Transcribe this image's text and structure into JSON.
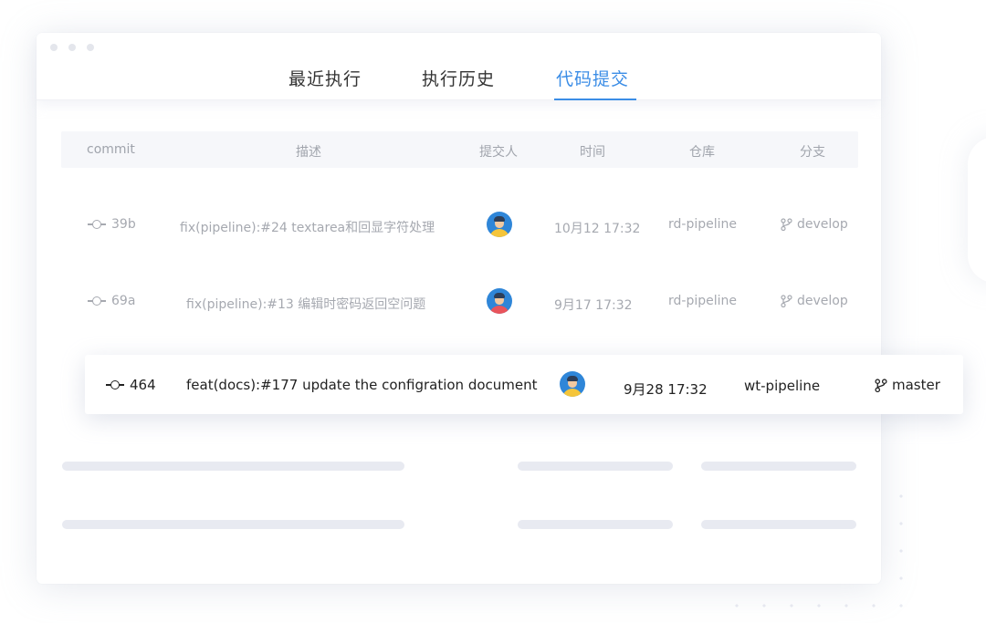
{
  "tabs": [
    {
      "label": "最近执行",
      "active": false
    },
    {
      "label": "执行历史",
      "active": false
    },
    {
      "label": "代码提交",
      "active": true
    }
  ],
  "colors": {
    "accent": "#3b8de6",
    "muted_text": "#a6a9b0",
    "skeleton": "#e8eaf1"
  },
  "table": {
    "columns": [
      "commit",
      "描述",
      "提交人",
      "时间",
      "仓库",
      "分支"
    ],
    "rows": [
      {
        "commit": "39b",
        "description": "fix(pipeline):#24 textarea和回显字符处理",
        "author_avatar": "avatar-blue-yellow",
        "time": "10月12 17:32",
        "repo": "rd-pipeline",
        "branch": "develop"
      },
      {
        "commit": "69a",
        "description": "fix(pipeline):#13 编辑时密码返回空问题",
        "author_avatar": "avatar-blue-red",
        "time": "9月17 17:32",
        "repo": "rd-pipeline",
        "branch": "develop"
      }
    ],
    "highlighted_row": {
      "commit": "464",
      "description": "feat(docs):#177 update the configration document",
      "author_avatar": "avatar-blue-yellow",
      "time": "9月28 17:32",
      "repo": "wt-pipeline",
      "branch": "master"
    }
  },
  "icons": {
    "commit": "git-commit-icon",
    "branch": "git-branch-icon"
  }
}
